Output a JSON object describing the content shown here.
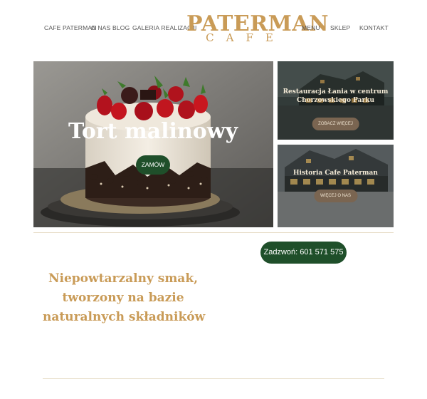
{
  "nav": {
    "left": [
      "CAFE PATERMAN",
      "O NAS",
      "BLOG",
      "GALERIA REALIZACJI"
    ],
    "right": [
      "MENU",
      "SKLEP",
      "KONTAKT"
    ]
  },
  "logo": {
    "main": "PATERMAN",
    "sub": "CAFE"
  },
  "hero": {
    "title": "Tort malinowy",
    "button": "ZAMÓW"
  },
  "cards": [
    {
      "title_line1": "Restauracja Łania w centrum",
      "title_line2": "Chorzowskiego Parku",
      "button": "ZOBACZ WIĘCEJ"
    },
    {
      "title": "Historia Cafe Paterman",
      "button": "WIĘCEJ O NAS"
    }
  ],
  "contact": {
    "call": "Zadzwoń: 601 571 575"
  },
  "tagline": [
    "Niepowtarzalny smak,",
    "tworzony na bazie",
    "naturalnych składników"
  ],
  "colors": {
    "gold": "#c99b57",
    "green": "#1f4f2a",
    "card_button": "#7a6551"
  }
}
